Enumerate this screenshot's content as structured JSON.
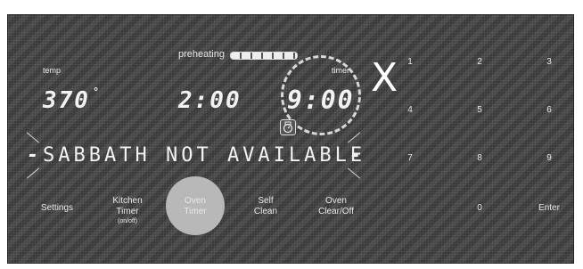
{
  "display": {
    "preheating_label": "preheating",
    "temp_label": "temp",
    "temp_value": "370",
    "temp_unit": "°",
    "cook_time": "2:00",
    "timer_label": "timer",
    "timer_value": "9:00",
    "message": "SABBATH NOT AVAILABLE",
    "message_prefix": "-",
    "message_suffix": "-",
    "annotation": "X"
  },
  "buttons": {
    "settings": "Settings",
    "kitchen_timer_line1": "Kitchen",
    "kitchen_timer_line2": "Timer",
    "kitchen_timer_sub": "(on/off)",
    "oven_timer_line1": "Oven",
    "oven_timer_line2": "Timer",
    "self_clean_line1": "Self",
    "self_clean_line2": "Clean",
    "oven_clear_line1": "Oven",
    "oven_clear_line2": "Clear/Off"
  },
  "keypad": {
    "k1": "1",
    "k2": "2",
    "k3": "3",
    "k4": "4",
    "k5": "5",
    "k6": "6",
    "k7": "7",
    "k8": "8",
    "k9": "9",
    "k0": "0",
    "enter": "Enter"
  },
  "icons": {
    "lock": "oven-lock-icon"
  }
}
